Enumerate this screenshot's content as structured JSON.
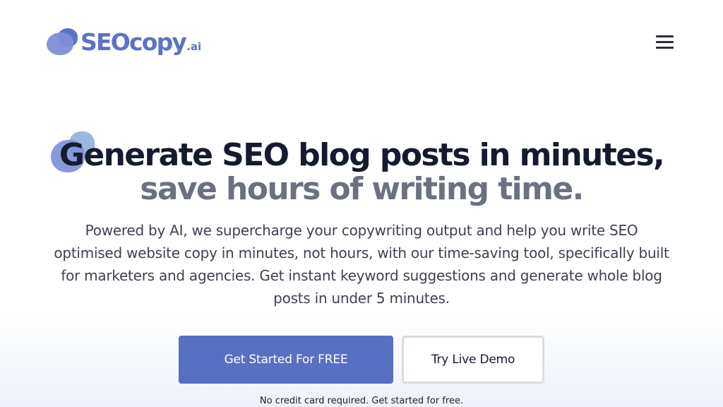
{
  "header": {
    "logo_text": "SEOcopy",
    "logo_suffix": ".ai",
    "brand_color": "#5b72c9",
    "menu_icon": "hamburger-menu-icon"
  },
  "hero": {
    "headline_line1": "Generate SEO blog posts in minutes,",
    "headline_line2": "save hours of writing time.",
    "subtext": "Powered by AI, we supercharge your copywriting output and help you write SEO optimised website copy in minutes, not hours, with our time-saving tool, specifically built for marketers and agencies. Get instant keyword suggestions and generate whole blog posts in under 5 minutes.",
    "primary_button_label": "Get Started For FREE",
    "secondary_button_label": "Try Live Demo",
    "note": "No credit card required. Get started for free.",
    "primary_color": "#5870c2",
    "headline_color": "#151b2e",
    "headline_secondary_color": "#6b7180"
  }
}
